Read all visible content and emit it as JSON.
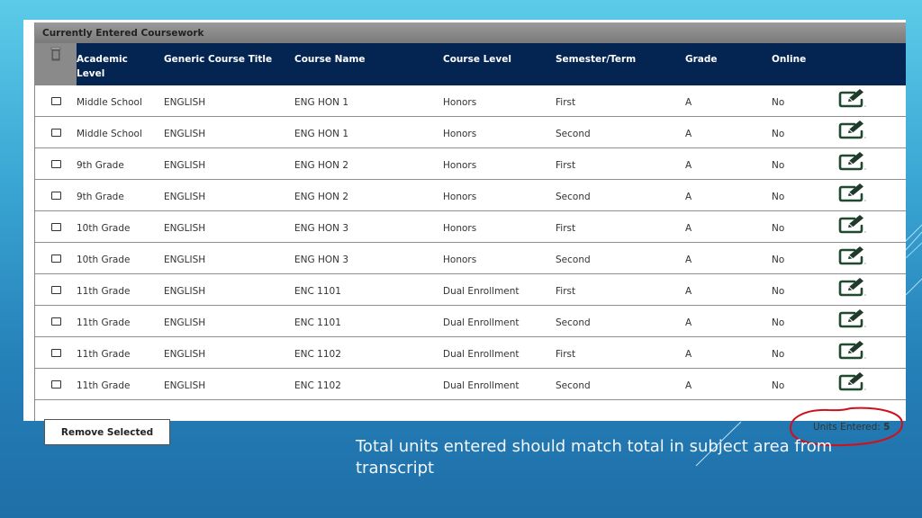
{
  "panel": {
    "caption": "Currently Entered Coursework",
    "columns": [
      {
        "key": "academic_level",
        "label": "Academic Level"
      },
      {
        "key": "generic_title",
        "label": "Generic Course Title"
      },
      {
        "key": "course_name",
        "label": "Course Name"
      },
      {
        "key": "course_level",
        "label": "Course Level"
      },
      {
        "key": "term",
        "label": "Semester/Term"
      },
      {
        "key": "grade",
        "label": "Grade"
      },
      {
        "key": "online",
        "label": "Online"
      }
    ],
    "header_icon": "trash-icon",
    "row_icon": "edit-icon",
    "rows": [
      {
        "academic_level": "Middle School",
        "generic_title": "ENGLISH",
        "course_name": "ENG HON 1",
        "course_level": "Honors",
        "term": "First",
        "grade": "A",
        "online": "No"
      },
      {
        "academic_level": "Middle School",
        "generic_title": "ENGLISH",
        "course_name": "ENG HON 1",
        "course_level": "Honors",
        "term": "Second",
        "grade": "A",
        "online": "No"
      },
      {
        "academic_level": "9th Grade",
        "generic_title": "ENGLISH",
        "course_name": "ENG HON 2",
        "course_level": "Honors",
        "term": "First",
        "grade": "A",
        "online": "No"
      },
      {
        "academic_level": "9th Grade",
        "generic_title": "ENGLISH",
        "course_name": "ENG HON 2",
        "course_level": "Honors",
        "term": "Second",
        "grade": "A",
        "online": "No"
      },
      {
        "academic_level": "10th Grade",
        "generic_title": "ENGLISH",
        "course_name": "ENG HON 3",
        "course_level": "Honors",
        "term": "First",
        "grade": "A",
        "online": "No"
      },
      {
        "academic_level": "10th Grade",
        "generic_title": "ENGLISH",
        "course_name": "ENG HON 3",
        "course_level": "Honors",
        "term": "Second",
        "grade": "A",
        "online": "No"
      },
      {
        "academic_level": "11th Grade",
        "generic_title": "ENGLISH",
        "course_name": "ENC 1101",
        "course_level": "Dual Enrollment",
        "term": "First",
        "grade": "A",
        "online": "No"
      },
      {
        "academic_level": "11th Grade",
        "generic_title": "ENGLISH",
        "course_name": "ENC 1101",
        "course_level": "Dual Enrollment",
        "term": "Second",
        "grade": "A",
        "online": "No"
      },
      {
        "academic_level": "11th Grade",
        "generic_title": "ENGLISH",
        "course_name": "ENC 1102",
        "course_level": "Dual Enrollment",
        "term": "First",
        "grade": "A",
        "online": "No"
      },
      {
        "academic_level": "11th Grade",
        "generic_title": "ENGLISH",
        "course_name": "ENC 1102",
        "course_level": "Dual Enrollment",
        "term": "Second",
        "grade": "A",
        "online": "No"
      }
    ],
    "remove_button": "Remove Selected",
    "units_label": "Units Entered:",
    "units_value": "5"
  },
  "slide": {
    "note": "Total units entered should match total in subject area from transcript"
  },
  "colors": {
    "header_bg": "#042451",
    "caption_bg": "#808080",
    "edit_icon": "#1f4a2f",
    "annotation": "#d0101c"
  }
}
